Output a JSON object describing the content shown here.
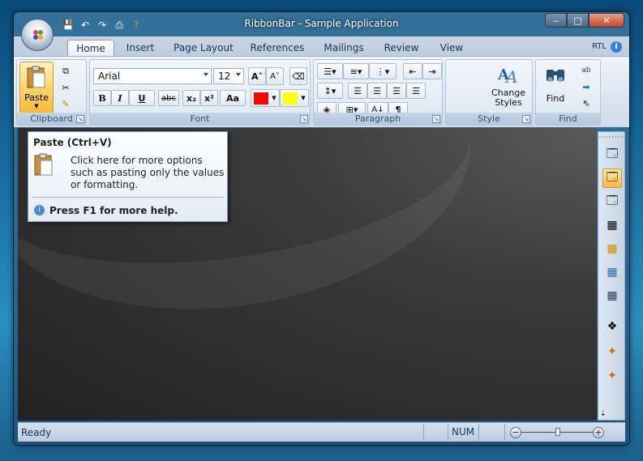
{
  "window": {
    "title": "RibbonBar - Sample Application",
    "minimize": "‒",
    "maximize": "□",
    "close": "✕"
  },
  "quick_access": {
    "save": "💾",
    "undo": "↶",
    "redo": "↷",
    "print": "⎙",
    "help": "?"
  },
  "tabs": [
    "Home",
    "Insert",
    "Page Layout",
    "References",
    "Mailings",
    "Review",
    "View"
  ],
  "active_tab": "Home",
  "rtl_label": "RTL",
  "help_icon": "i",
  "groups": {
    "clipboard": {
      "label": "Clipboard",
      "paste_label": "Paste"
    },
    "font": {
      "label": "Font",
      "font_name": "Arial",
      "font_size": "12",
      "grow": "A˄",
      "shrink": "A˅",
      "bold": "B",
      "italic": "I",
      "underline": "U",
      "strike": "abc",
      "subscript": "x₂",
      "superscript": "x²",
      "case": "Aa",
      "font_color": "#ff0000",
      "highlight_color": "#ffff00"
    },
    "paragraph": {
      "label": "Paragraph",
      "pilcrow": "¶",
      "sort": "A↓"
    },
    "style": {
      "label": "Style",
      "change_styles": "Change Styles",
      "line1": "Change",
      "line2": "Styles"
    },
    "find": {
      "label": "Find",
      "find_label": "Find"
    }
  },
  "tooltip": {
    "title": "Paste (Ctrl+V)",
    "body": "Click here for more options such as pasting only the values or formatting.",
    "footer": "Press F1 for more help."
  },
  "status": {
    "ready": "Ready",
    "num": "NUM",
    "zoom_minus": "−",
    "zoom_plus": "+"
  }
}
